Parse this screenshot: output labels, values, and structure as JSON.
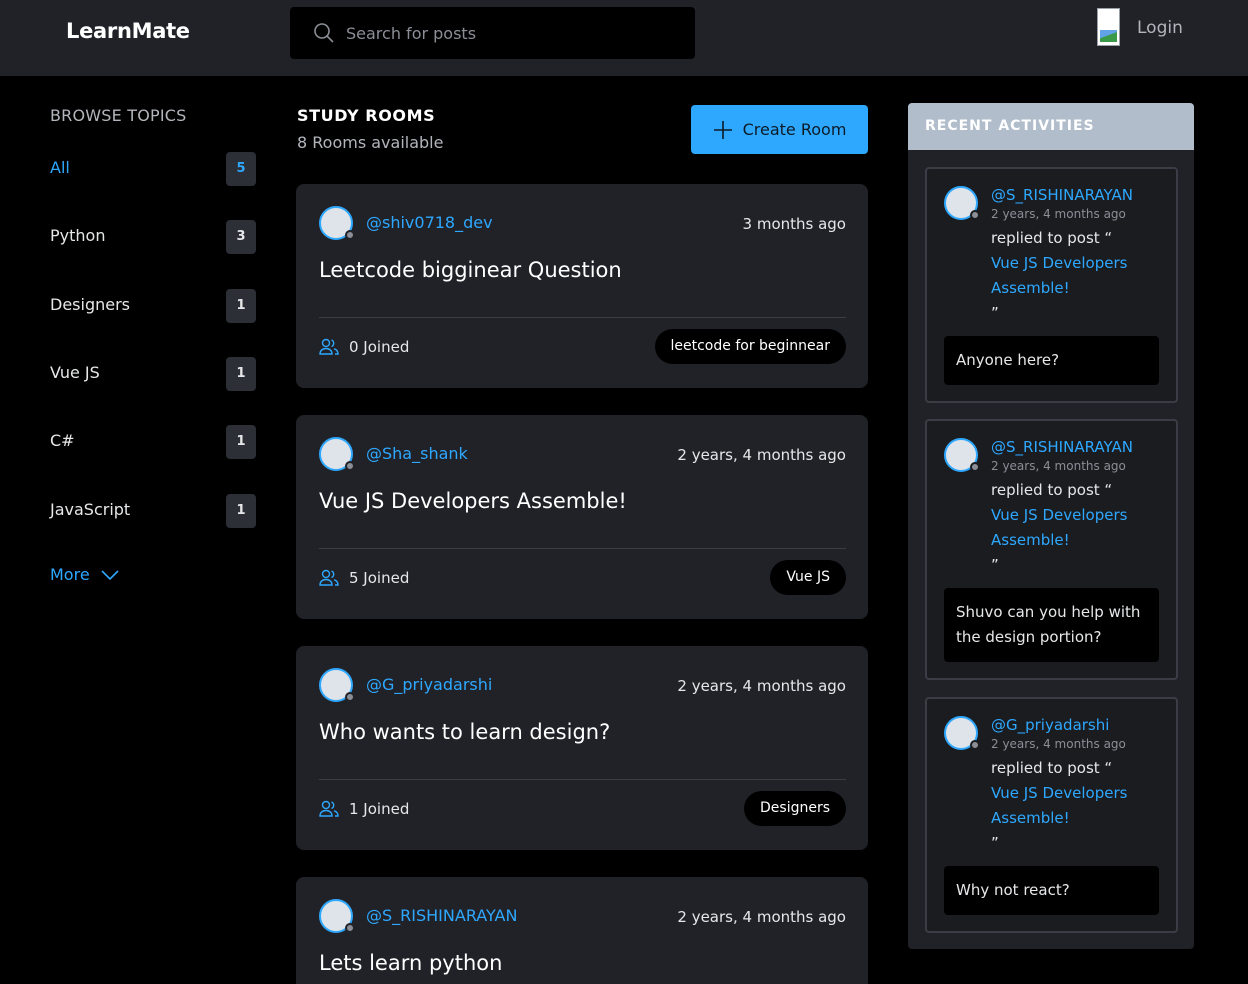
{
  "header": {
    "logo": "LearnMate",
    "search_placeholder": "Search for posts",
    "login_label": "Login"
  },
  "topics": {
    "title": "BROWSE TOPICS",
    "items": [
      {
        "name": "All",
        "count": "5"
      },
      {
        "name": "Python",
        "count": "3"
      },
      {
        "name": "Designers",
        "count": "1"
      },
      {
        "name": "Vue JS",
        "count": "1"
      },
      {
        "name": "C#",
        "count": "1"
      },
      {
        "name": "JavaScript",
        "count": "1"
      }
    ],
    "more_label": "More"
  },
  "rooms": {
    "title": "STUDY ROOMS",
    "subtitle": "8 Rooms available",
    "create_label": "Create Room",
    "items": [
      {
        "host": "@shiv0718_dev",
        "time": "3 months ago",
        "title": "Leetcode bigginear Question",
        "joined": "0 Joined",
        "tag": "leetcode for beginnear"
      },
      {
        "host": "@Sha_shank",
        "time": "2 years, 4 months ago",
        "title": "Vue JS Developers Assemble!",
        "joined": "5 Joined",
        "tag": "Vue JS"
      },
      {
        "host": "@G_priyadarshi",
        "time": "2 years, 4 months ago",
        "title": "Who wants to learn design?",
        "joined": "1 Joined",
        "tag": "Designers"
      },
      {
        "host": "@S_RISHINARAYAN",
        "time": "2 years, 4 months ago",
        "title": "Lets learn python",
        "joined": "",
        "tag": ""
      }
    ]
  },
  "activities": {
    "title": "RECENT ACTIVITIES",
    "items": [
      {
        "user": "@S_RISHINARAYAN",
        "time": "2 years, 4 months ago",
        "action": "replied to post “",
        "post": "Vue JS Developers Assemble!",
        "close": "”",
        "message": "Anyone here?"
      },
      {
        "user": "@S_RISHINARAYAN",
        "time": "2 years, 4 months ago",
        "action": "replied to post “",
        "post": "Vue JS Developers Assemble!",
        "close": "”",
        "message": "Shuvo can you help with the design portion?"
      },
      {
        "user": "@G_priyadarshi",
        "time": "2 years, 4 months ago",
        "action": "replied to post “",
        "post": "Vue JS Developers Assemble!",
        "close": "”",
        "message": "Why not react?"
      }
    ]
  },
  "colors": {
    "accent": "#2ea8ff",
    "header_bg": "#202228",
    "card_bg": "#202228",
    "page_bg": "#000000",
    "activities_header": "#b2bdcc"
  },
  "icons": {
    "search": "search-icon",
    "create": "plus-icon",
    "more": "chevron-down-icon",
    "joined": "users-icon"
  }
}
